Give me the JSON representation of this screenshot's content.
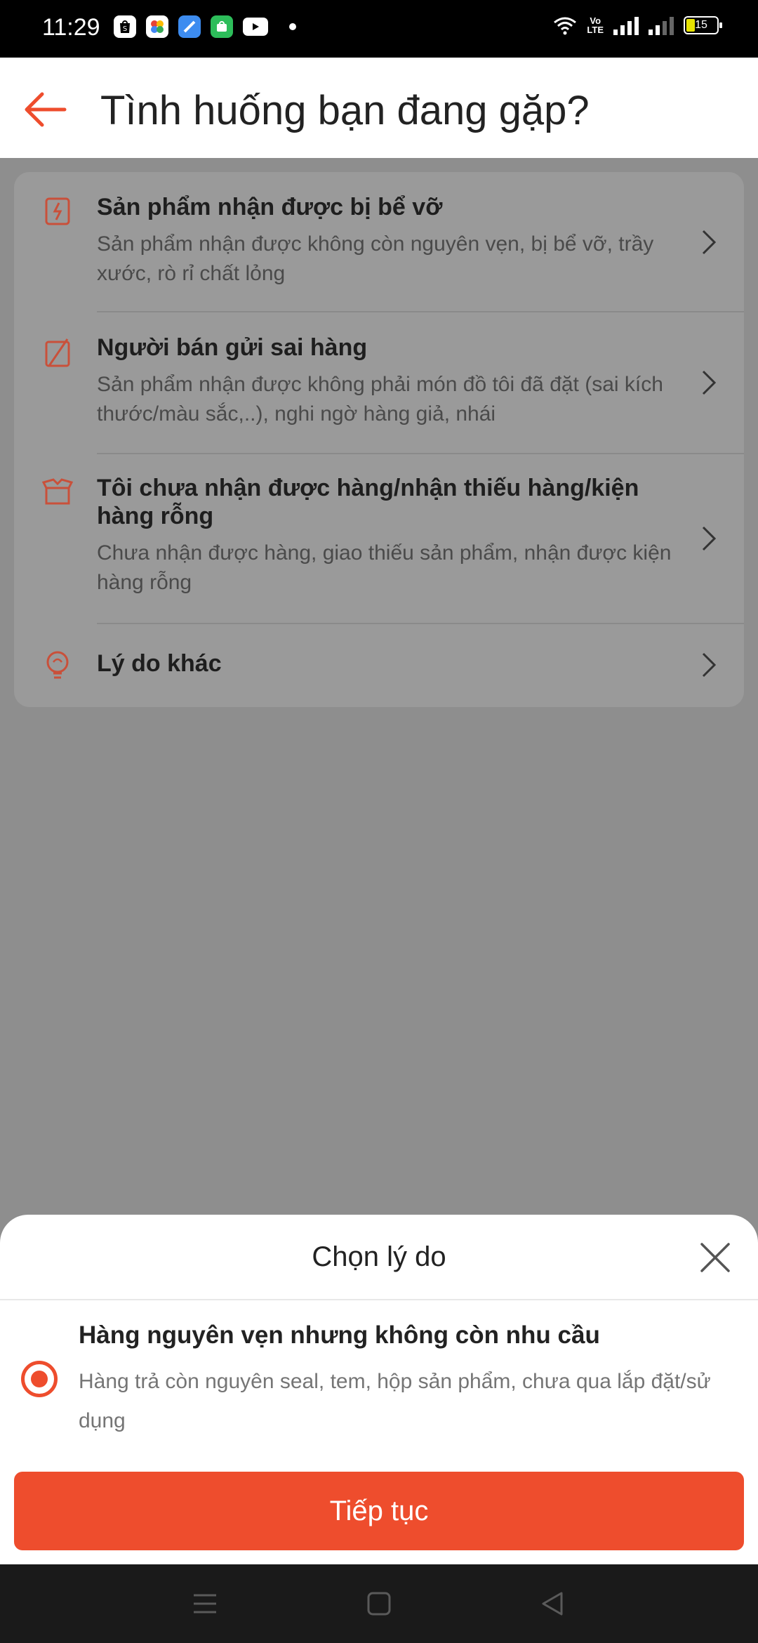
{
  "status_bar": {
    "time": "11:29",
    "volte": "Vo\nLTE",
    "battery": "15"
  },
  "header": {
    "title": "Tình huống bạn đang gặp?"
  },
  "list": {
    "items": [
      {
        "title": "Sản phẩm nhận được bị bể vỡ",
        "description": "Sản phẩm nhận được không còn nguyên vẹn, bị bể vỡ, trầy xước, rò rỉ chất lỏng",
        "icon": "broken-phone-icon"
      },
      {
        "title": "Người bán gửi sai hàng",
        "description": "Sản phẩm nhận được không phải món đồ tôi đã đặt (sai kích thước/màu sắc,..), nghi ngờ hàng giả, nhái",
        "icon": "wrong-item-icon"
      },
      {
        "title": "Tôi chưa nhận được hàng/nhận thiếu hàng/kiện hàng rỗng",
        "description": "Chưa nhận được hàng, giao thiếu sản phẩm, nhận được kiện hàng rỗng",
        "icon": "open-box-icon"
      },
      {
        "title": "Lý do khác",
        "description": "",
        "icon": "lightbulb-icon"
      }
    ]
  },
  "sheet": {
    "title": "Chọn lý do",
    "option": {
      "title": "Hàng nguyên vẹn nhưng không còn nhu cầu",
      "description": "Hàng trả còn nguyên seal, tem, hộp sản phẩm, chưa qua lắp đặt/sử dụng",
      "selected": true
    },
    "button": "Tiếp tục"
  },
  "colors": {
    "accent": "#ee4d2d",
    "overlay": "#8e8e8e"
  }
}
